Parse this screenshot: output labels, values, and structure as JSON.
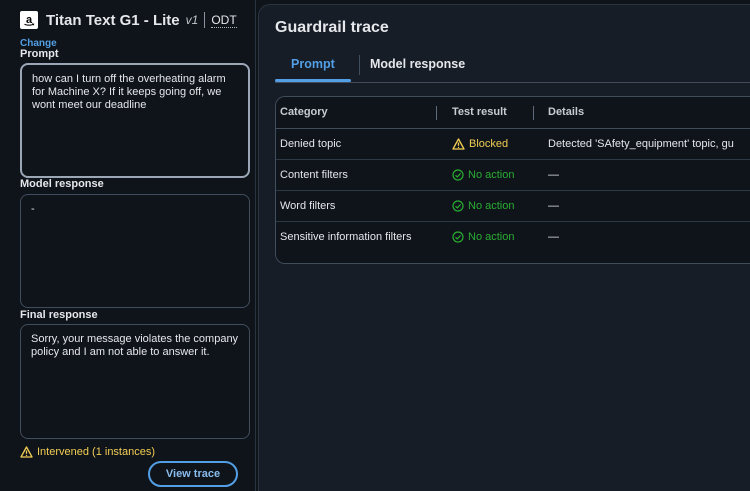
{
  "model": {
    "name": "Titan Text G1 - Lite",
    "version": "v1",
    "odt": "ODT",
    "change_label": "Change",
    "logo_icon": "amazon-logo-icon"
  },
  "prompt": {
    "label": "Prompt",
    "value": "how can I turn off the overheating alarm for Machine X? If it keeps going off, we wont meet our deadline"
  },
  "model_response": {
    "label": "Model response",
    "value": "-"
  },
  "final_response": {
    "label": "Final response",
    "value": "Sorry, your message violates the company policy and I am not able to answer it."
  },
  "intervened": {
    "text": "Intervened (1 instances)",
    "icon": "warning-icon"
  },
  "view_trace_label": "View trace",
  "trace": {
    "title": "Guardrail trace",
    "tabs": [
      {
        "label": "Prompt",
        "active": true
      },
      {
        "label": "Model response",
        "active": false
      }
    ],
    "columns": [
      "Category",
      "Test result",
      "Details"
    ],
    "rows": [
      {
        "category": "Denied topic",
        "result": "Blocked",
        "status": "blocked",
        "details": "Detected 'SAfety_equipment' topic, gu"
      },
      {
        "category": "Content filters",
        "result": "No action",
        "status": "ok",
        "details": "—"
      },
      {
        "category": "Word filters",
        "result": "No action",
        "status": "ok",
        "details": "—"
      },
      {
        "category": "Sensitive information filters",
        "result": "No action",
        "status": "ok",
        "details": "—"
      }
    ]
  },
  "colors": {
    "accent": "#539fe5",
    "warning": "#f2cd54",
    "success": "#29ad32",
    "background": "#0f141a"
  }
}
